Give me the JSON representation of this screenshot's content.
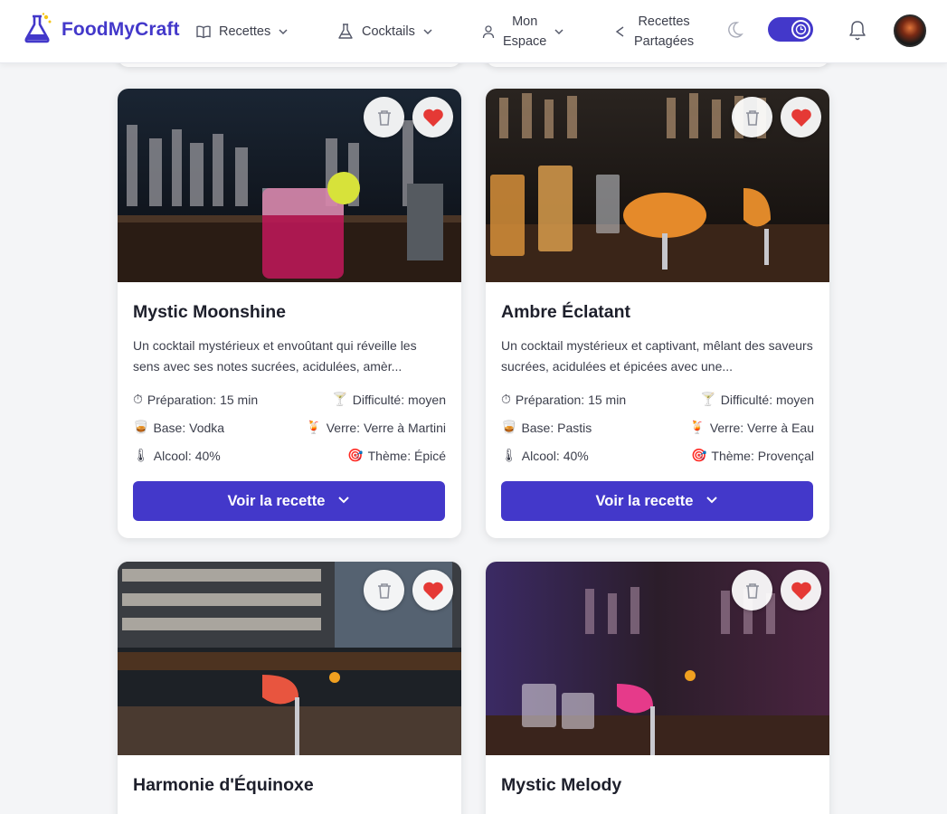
{
  "app": {
    "name": "FoodMyCraft"
  },
  "nav": {
    "recettes": "Recettes",
    "cocktails": "Cocktails",
    "mon_espace_line1": "Mon",
    "mon_espace_line2": "Espace",
    "partagees_line1": "Recettes",
    "partagees_line2": "Partagées"
  },
  "colors": {
    "accent": "#4338ca",
    "heart": "#e53935"
  },
  "cards": [
    {
      "title": "Mystic Moonshine",
      "description": "Un cocktail mystérieux et envoûtant qui réveille les sens avec ses notes sucrées, acidulées, amèr...",
      "preparation": "Préparation: 15 min",
      "difficulty": "Difficulté: moyen",
      "base": "Base: Vodka",
      "glass": "Verre: Verre à Martini",
      "alcohol": "Alcool: 40%",
      "theme": "Thème: Épicé",
      "button": "Voir la recette"
    },
    {
      "title": "Ambre Éclatant",
      "description": "Un cocktail mystérieux et captivant, mêlant des saveurs sucrées, acidulées et épicées avec une...",
      "preparation": "Préparation: 15 min",
      "difficulty": "Difficulté: moyen",
      "base": "Base: Pastis",
      "glass": "Verre: Verre à Eau",
      "alcohol": "Alcool: 40%",
      "theme": "Thème: Provençal",
      "button": "Voir la recette"
    },
    {
      "title": "Harmonie d'Équinoxe"
    },
    {
      "title": "Mystic Melody"
    }
  ]
}
